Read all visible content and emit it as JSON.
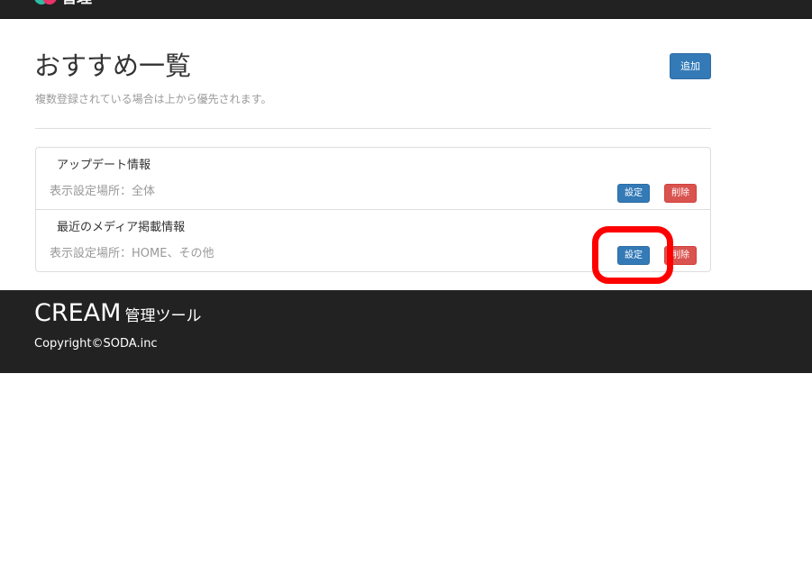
{
  "header": {
    "logo_icon": "cream-logo-icon",
    "logo_text": "管理"
  },
  "page": {
    "title": "おすすめ一覧",
    "description": "複数登録されている場合は上から優先されます。",
    "add_label": "追加"
  },
  "items": [
    {
      "title": "アップデート情報",
      "meta": "表示設定場所：全体",
      "set_label": "設定",
      "delete_label": "削除"
    },
    {
      "title": "最近のメディア掲載情報",
      "meta": "表示設定場所：HOME、その他",
      "set_label": "設定",
      "delete_label": "削除"
    }
  ],
  "footer": {
    "brand": "CREAM",
    "brand_sub": "管理ツール",
    "copyright": "Copyright©SODA.inc"
  },
  "colors": {
    "primary": "#337ab7",
    "danger": "#d9534f",
    "dark": "#222222",
    "highlight": "#ff0000"
  }
}
